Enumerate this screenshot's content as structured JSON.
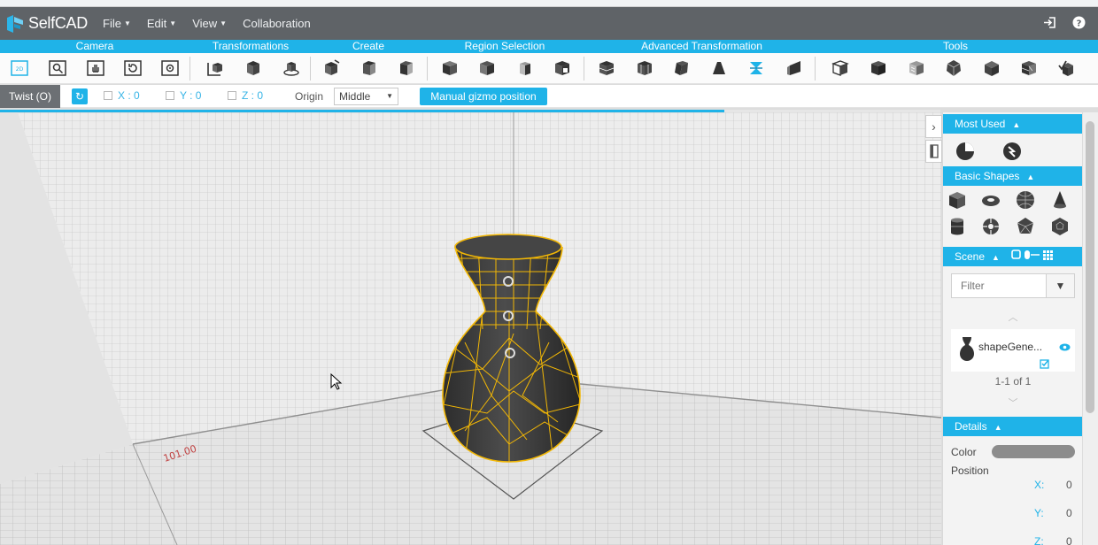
{
  "app": {
    "name": "SelfCAD"
  },
  "menu": {
    "file": "File",
    "edit": "Edit",
    "view": "View",
    "collaboration": "Collaboration"
  },
  "categories": {
    "camera": "Camera",
    "transformations": "Transformations",
    "create": "Create",
    "region_selection": "Region Selection",
    "advanced_transformation": "Advanced Transformation",
    "tools": "Tools"
  },
  "options": {
    "tool_name": "Twist (O)",
    "x_label": "X : 0",
    "y_label": "Y : 0",
    "z_label": "Z : 0",
    "origin_label": "Origin",
    "origin_value": "Middle",
    "gizmo_button": "Manual gizmo position"
  },
  "progress_fraction": 0.77,
  "viewport": {
    "grid_label": "101.00"
  },
  "panel": {
    "most_used": "Most Used",
    "basic_shapes": "Basic Shapes",
    "scene": "Scene",
    "filter_placeholder": "Filter",
    "scene_item": "shapeGene...",
    "pager": "1-1 of 1",
    "details": "Details",
    "color_label": "Color",
    "position_label": "Position",
    "x_key": "X:",
    "x_val": "0",
    "y_key": "Y:",
    "y_val": "0",
    "z_key": "Z:",
    "z_val": "0"
  },
  "colors": {
    "accent": "#1fb3e8",
    "menubar": "#5f6367",
    "wireframe": "#f2b705",
    "model": "#3f3f3f"
  }
}
